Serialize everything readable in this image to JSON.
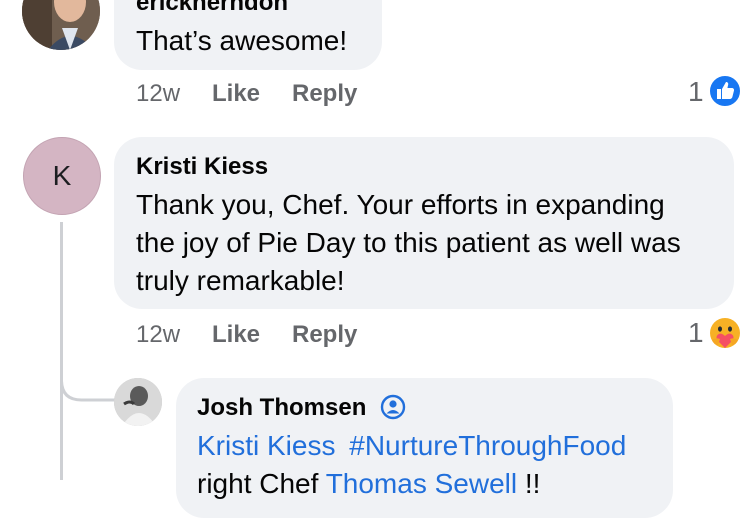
{
  "comments": [
    {
      "author": "erickherndon",
      "text": "That’s awesome!",
      "time": "12w",
      "like_label": "Like",
      "reply_label": "Reply",
      "reaction_count": "1",
      "reaction_icon": "like-reaction-icon"
    },
    {
      "author": "Kristi Kiess",
      "avatar_letter": "K",
      "text_lines": [
        "Thank you, Chef. Your efforts in expanding",
        "the joy of Pie Day to this patient as well was",
        "truly remarkable!"
      ],
      "time": "12w",
      "like_label": "Like",
      "reply_label": "Reply",
      "reaction_count": "1",
      "reaction_icon": "care-reaction-icon"
    },
    {
      "author": "Josh Thomsen",
      "author_badge_icon": "profile-badge-icon",
      "mention1": "Kristi Kiess",
      "hashtag": "#NurtureThroughFood",
      "line2_prefix": "right Chef",
      "mention2": "Thomas Sewell",
      "line2_suffix": "!!"
    }
  ],
  "colors": {
    "bubble": "#f0f2f5",
    "link": "#216fdb",
    "meta_text": "#65676b",
    "avatar_k_bg": "#d4b5c3",
    "like_blue": "#1877f2"
  }
}
